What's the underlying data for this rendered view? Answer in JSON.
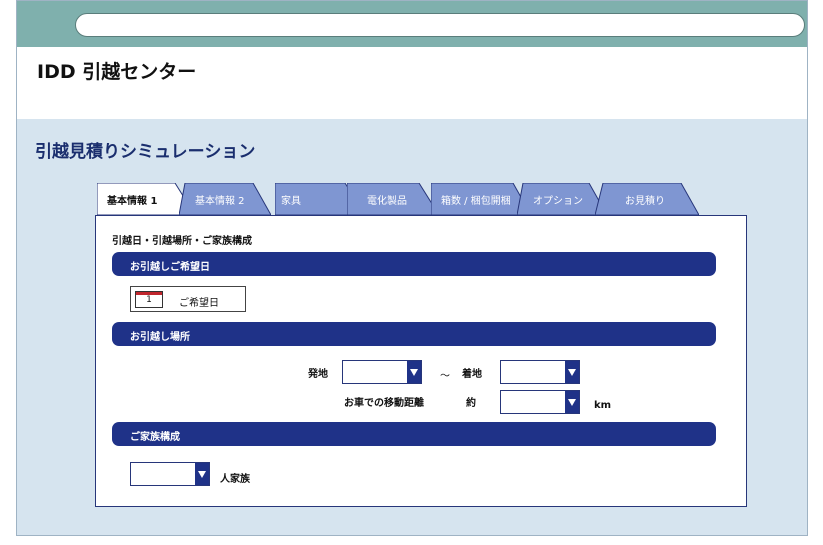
{
  "browser": {
    "address_value": ""
  },
  "header": {
    "site_title": "IDD 引越センター"
  },
  "main": {
    "page_title": "引越見積りシミュレーション"
  },
  "tabs": [
    {
      "label": "基本情報 1",
      "active": true
    },
    {
      "label": "基本情報 2",
      "active": false
    },
    {
      "label": "家具",
      "active": false
    },
    {
      "label": "電化製品",
      "active": false
    },
    {
      "label": "箱数 / 梱包開梱",
      "active": false
    },
    {
      "label": "オプション",
      "active": false
    },
    {
      "label": "お見積り",
      "active": false
    }
  ],
  "panel": {
    "heading": "引越日・引越場所・ご家族構成",
    "sections": {
      "date": {
        "title": "お引越しご希望日",
        "calendar_day": "1",
        "label": "ご希望日"
      },
      "location": {
        "title": "お引越し場所",
        "from_label": "発地",
        "tilde": "〜",
        "to_label": "着地",
        "distance_label": "お車での移動距離",
        "approx_label": "約",
        "unit": "km",
        "from_value": "",
        "to_value": "",
        "distance_value": ""
      },
      "family": {
        "title": "ご家族構成",
        "count_value": "",
        "suffix": "人家族"
      }
    }
  },
  "colors": {
    "topbar": "#7fb0ad",
    "background": "#d6e4ef",
    "accent": "#1f3288",
    "inactive_tab": "#7f96d2",
    "calendar_red": "#c0262d"
  }
}
